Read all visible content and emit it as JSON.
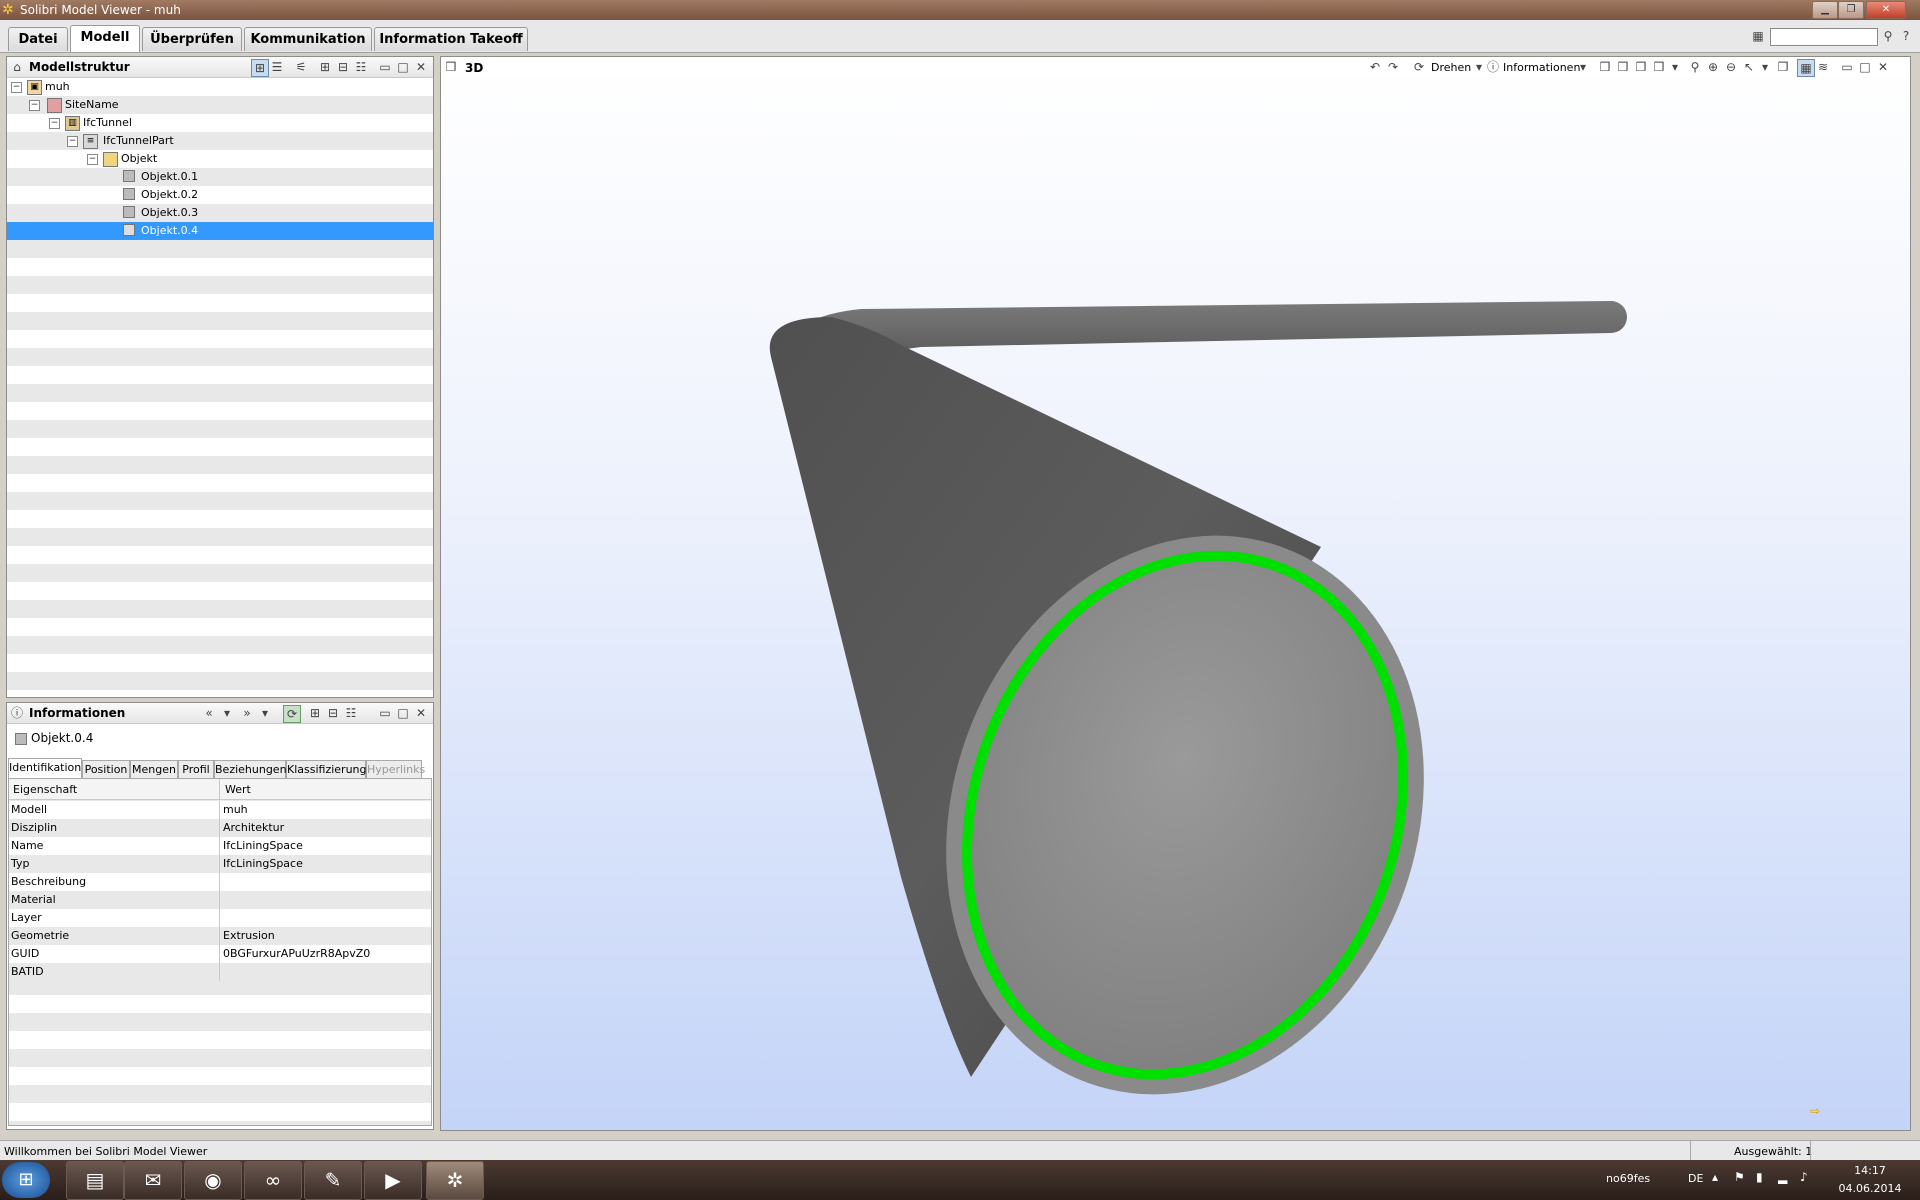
{
  "window": {
    "title": "Solibri Model Viewer - muh"
  },
  "menu_tabs": [
    "Datei",
    "Modell",
    "Überprüfen",
    "Kommunikation",
    "Information Takeoff"
  ],
  "active_menu_tab": "Modell",
  "model_tree": {
    "title": "Modellstruktur",
    "items": [
      {
        "label": "muh",
        "level": 0
      },
      {
        "label": "SiteName",
        "level": 1
      },
      {
        "label": "IfcTunnel",
        "level": 2
      },
      {
        "label": "IfcTunnelPart",
        "level": 3
      },
      {
        "label": "Objekt",
        "level": 4
      },
      {
        "label": "Objekt.0.1",
        "level": 5
      },
      {
        "label": "Objekt.0.2",
        "level": 5
      },
      {
        "label": "Objekt.0.3",
        "level": 5
      },
      {
        "label": "Objekt.0.4",
        "level": 5,
        "selected": true
      }
    ]
  },
  "info_panel": {
    "title": "Informationen",
    "object_name": "Objekt.0.4",
    "tabs": [
      "Identifikation",
      "Position",
      "Mengen",
      "Profil",
      "Beziehungen",
      "Klassifizierung",
      "Hyperlinks"
    ],
    "active_tab": "Identifikation",
    "disabled_tab": "Hyperlinks",
    "columns": [
      "Eigenschaft",
      "Wert"
    ],
    "rows": [
      [
        "Modell",
        "muh"
      ],
      [
        "Disziplin",
        "Architektur"
      ],
      [
        "Name",
        "IfcLiningSpace"
      ],
      [
        "Typ",
        "IfcLiningSpace"
      ],
      [
        "Beschreibung",
        ""
      ],
      [
        "Material",
        ""
      ],
      [
        "Layer",
        ""
      ],
      [
        "Geometrie",
        "Extrusion"
      ],
      [
        "GUID",
        "0BGFurxurAPuUzrR8ApvZ0"
      ],
      [
        "BATID",
        ""
      ]
    ]
  },
  "view3d": {
    "title": "3D",
    "rotate_label": "Drehen",
    "info_label": "Informationen",
    "accent_color": "#00e000"
  },
  "status": {
    "message": "Willkommen bei Solibri Model Viewer",
    "selected": "Ausgewählt: 1"
  },
  "taskbar": {
    "user": "no69fes",
    "language": "DE",
    "time": "14:17",
    "date": "04.06.2014"
  }
}
